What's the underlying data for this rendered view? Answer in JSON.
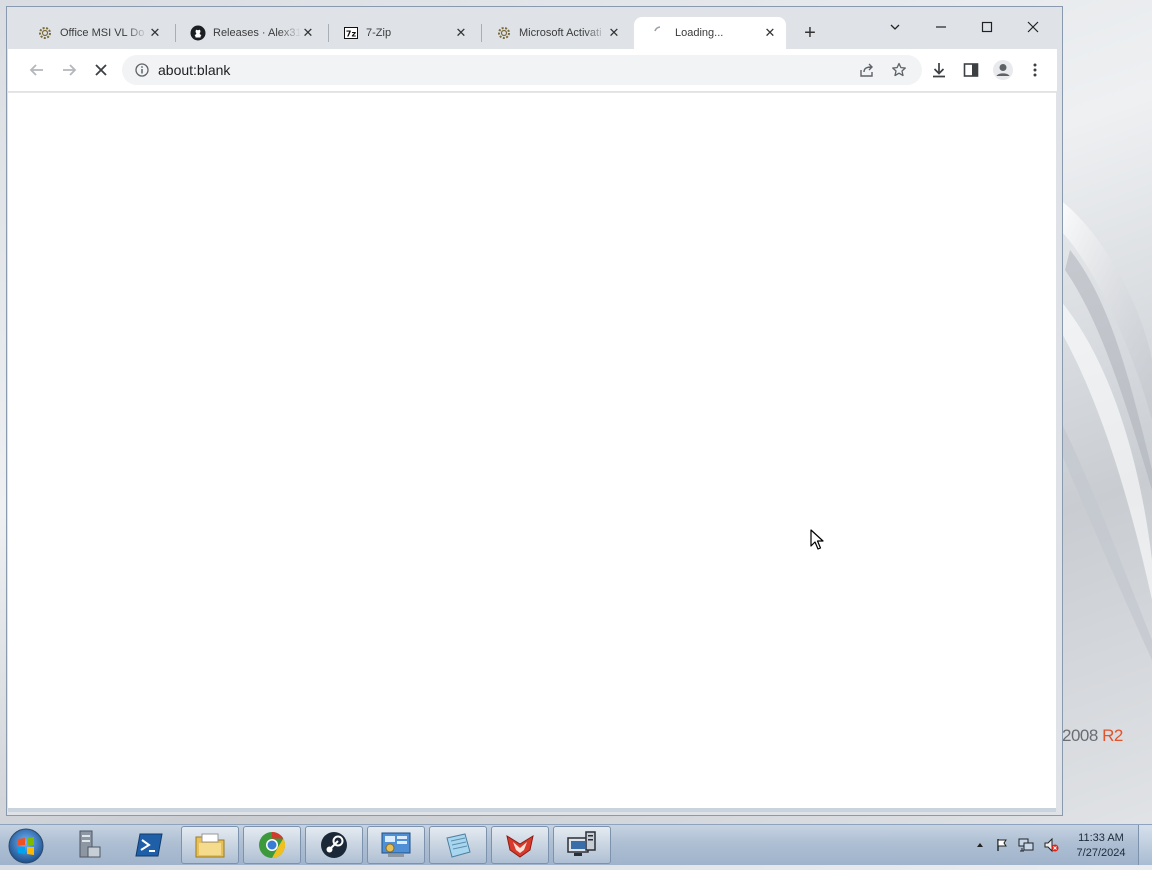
{
  "browser": {
    "tabs": [
      {
        "label": "Office MSI VL Do",
        "favicon": "gear-icon",
        "active": false
      },
      {
        "label": "Releases · Alex31",
        "favicon": "github-icon",
        "active": false
      },
      {
        "label": "7-Zip",
        "favicon": "7zip-icon",
        "active": false
      },
      {
        "label": "Microsoft Activati",
        "favicon": "gear-icon",
        "active": false
      },
      {
        "label": "Loading...",
        "favicon": "loading-spinner-icon",
        "active": true
      }
    ],
    "address": "about:blank"
  },
  "desktop": {
    "os_brand_main": "2008",
    "os_brand_accent": "R2",
    "accent_color": "#e2542b"
  },
  "taskbar": {
    "apps": [
      "server-manager-icon",
      "powershell-icon",
      "file-explorer-icon",
      "chrome-icon",
      "steam-icon",
      "control-panel-icon",
      "notepad-icon",
      "fox-app-icon",
      "remote-desktop-icon"
    ],
    "clock_time": "11:33 AM",
    "clock_date": "7/27/2024"
  }
}
